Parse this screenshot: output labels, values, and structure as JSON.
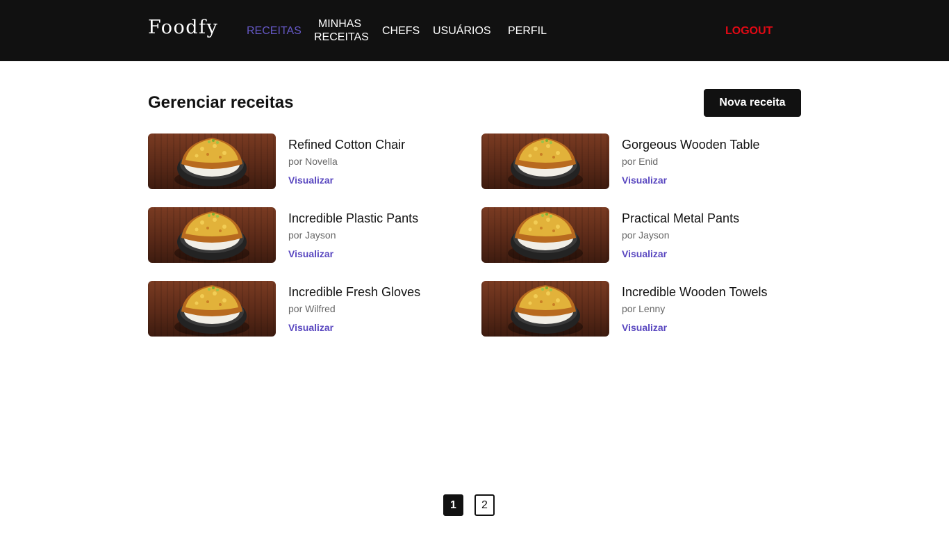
{
  "header": {
    "logo": "Foodfy",
    "nav": [
      {
        "label": "RECEITAS",
        "active": true
      },
      {
        "label": "MINHAS RECEITAS",
        "line1": "MINHAS",
        "line2": "RECEITAS",
        "active": false
      },
      {
        "label": "CHEFS",
        "active": false
      },
      {
        "label": "USUÁRIOS",
        "active": false
      },
      {
        "label": "PERFIL",
        "active": false
      }
    ],
    "logout": "LOGOUT"
  },
  "main": {
    "title": "Gerenciar receitas",
    "new_button": "Nova receita",
    "recipes": [
      {
        "title": "Refined Cotton Chair",
        "author": "por Novella",
        "link": "Visualizar"
      },
      {
        "title": "Gorgeous Wooden Table",
        "author": "por Enid",
        "link": "Visualizar"
      },
      {
        "title": "Incredible Plastic Pants",
        "author": "por Jayson",
        "link": "Visualizar"
      },
      {
        "title": "Practical Metal Pants",
        "author": "por Jayson",
        "link": "Visualizar"
      },
      {
        "title": "Incredible Fresh Gloves",
        "author": "por Wilfred",
        "link": "Visualizar"
      },
      {
        "title": "Incredible Wooden Towels",
        "author": "por Lenny",
        "link": "Visualizar"
      }
    ]
  },
  "pagination": {
    "pages": [
      "1",
      "2"
    ],
    "current": "1"
  },
  "colors": {
    "header_bg": "#111111",
    "accent": "#5a48c0",
    "logout": "#e30914"
  }
}
